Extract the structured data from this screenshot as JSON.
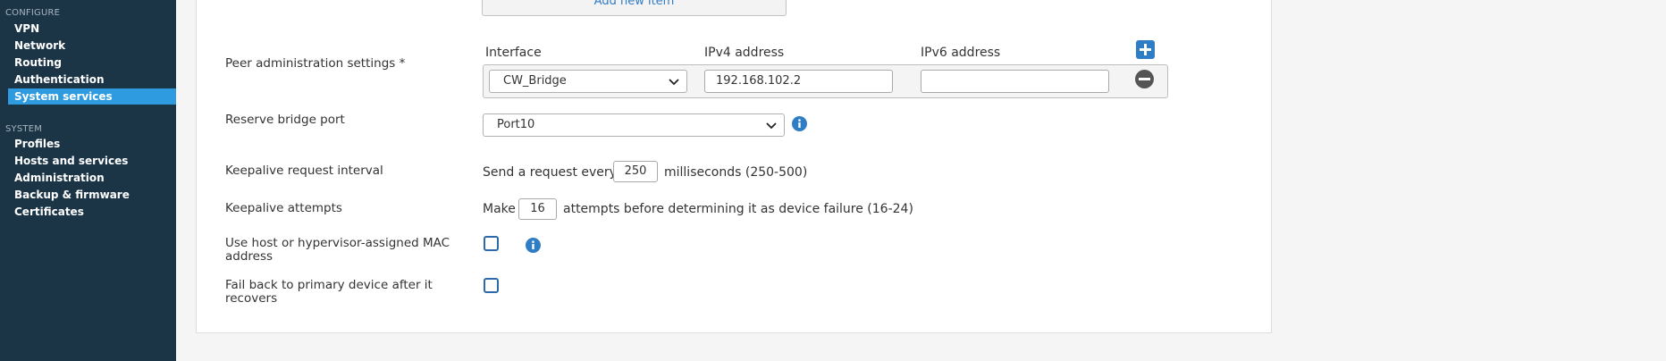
{
  "sidebar": {
    "configure_label": "CONFIGURE",
    "configure_items": [
      {
        "label": "VPN"
      },
      {
        "label": "Network"
      },
      {
        "label": "Routing"
      },
      {
        "label": "Authentication"
      },
      {
        "label": "System services",
        "active": true
      }
    ],
    "system_label": "SYSTEM",
    "system_items": [
      {
        "label": "Profiles"
      },
      {
        "label": "Hosts and services"
      },
      {
        "label": "Administration"
      },
      {
        "label": "Backup & firmware"
      },
      {
        "label": "Certificates"
      }
    ]
  },
  "form": {
    "add_new_item": "Add new item",
    "peer_admin": {
      "label": "Peer administration settings *",
      "col_interface": "Interface",
      "col_ipv4": "IPv4 address",
      "col_ipv6": "IPv6 address",
      "interface_value": "CW_Bridge",
      "ipv4_value": "192.168.102.2",
      "ipv6_value": ""
    },
    "reserve_bridge_port": {
      "label": "Reserve bridge port",
      "value": "Port10"
    },
    "keepalive_interval": {
      "label": "Keepalive request interval",
      "prefix": "Send a request every",
      "value": "250",
      "suffix": "milliseconds (250-500)"
    },
    "keepalive_attempts": {
      "label": "Keepalive attempts",
      "prefix": "Make",
      "value": "16",
      "suffix": "attempts before determining it as device failure (16-24)"
    },
    "use_mac": {
      "label_line1": "Use host or hypervisor-assigned MAC",
      "label_line2": "address",
      "checked": false
    },
    "fail_back": {
      "label_line1": "Fail back to primary device after it",
      "label_line2": "recovers",
      "checked": false
    }
  },
  "colors": {
    "sidebar_bg": "#1b3547",
    "active_item": "#2e9be0",
    "accent_blue": "#2f7dc4",
    "remove_gray": "#555555"
  },
  "icons": [
    "add-row-icon",
    "remove-row-icon",
    "info-icon",
    "chevron-down-icon"
  ]
}
